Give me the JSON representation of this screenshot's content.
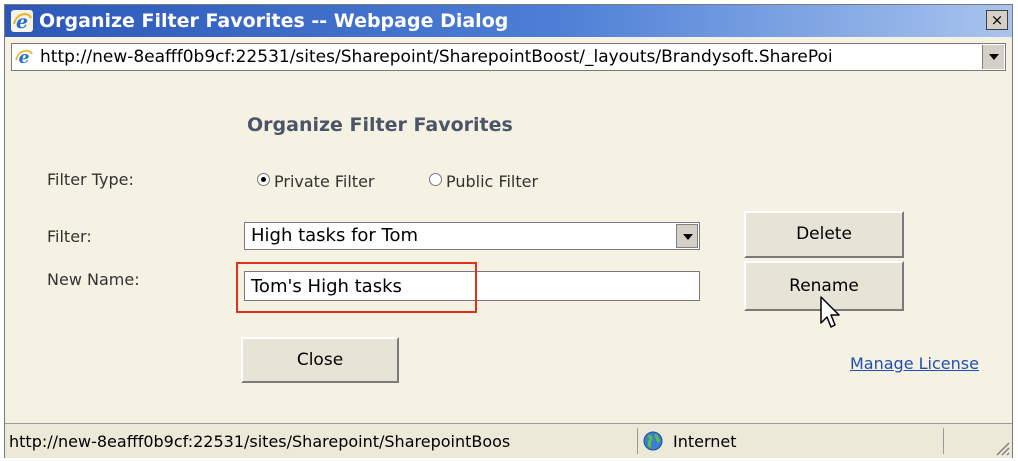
{
  "window": {
    "title": "Organize Filter Favorites -- Webpage Dialog",
    "close_label": "×"
  },
  "address_bar": {
    "url": "http://new-8eafff0b9cf:22531/sites/Sharepoint/SharepointBoost/_layouts/Brandysoft.SharePoi"
  },
  "dialog": {
    "heading": "Organize Filter Favorites",
    "filter_type_label": "Filter Type:",
    "filter_type_options": [
      {
        "label": "Private Filter",
        "checked": true
      },
      {
        "label": "Public Filter",
        "checked": false
      }
    ],
    "filter_label": "Filter:",
    "filter_selected": "High tasks for Tom",
    "new_name_label": "New Name:",
    "new_name_value": "Tom's High tasks",
    "delete_label": "Delete",
    "rename_label": "Rename",
    "close_label": "Close",
    "manage_license_label": "Manage License"
  },
  "status_bar": {
    "url": "http://new-8eafff0b9cf:22531/sites/Sharepoint/SharepointBoos",
    "zone": "Internet"
  },
  "icons": {
    "title": "ie-logo-icon",
    "address": "ie-page-icon",
    "zone": "globe-icon",
    "cursor": "arrow-cursor-icon"
  },
  "colors": {
    "title_bar": "#2c57b8",
    "dialog_bg": "#f5f1e3",
    "highlight": "#e0301e",
    "link": "#1e50b4"
  }
}
